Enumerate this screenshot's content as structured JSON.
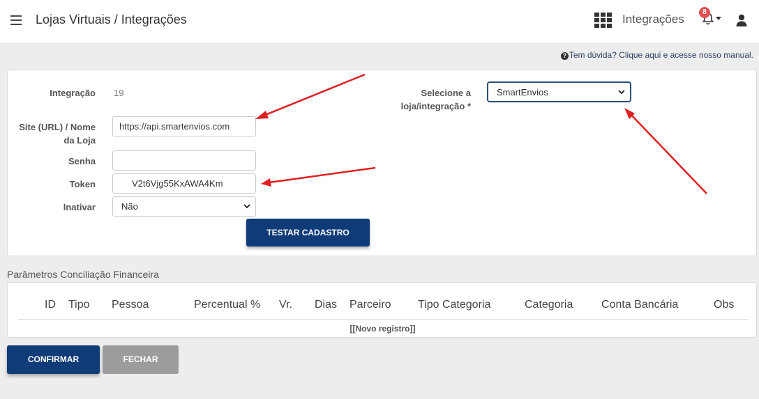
{
  "header": {
    "title": "Lojas Virtuais / Integrações",
    "integrations_link": "Integrações",
    "notification_count": "8"
  },
  "help": {
    "text": "Tem dúvida? Clique aqui e acesse nosso manual."
  },
  "form": {
    "integracao_label": "Integração",
    "integracao_value": "19",
    "site_label": "Site (URL) / Nome da Loja",
    "site_value": "https://api.smartenvios.com",
    "senha_label": "Senha",
    "senha_value": "",
    "token_label": "Token",
    "token_value": "V2t6Vjg55KxAWA4Km",
    "inativar_label": "Inativar",
    "inativar_value": "Não",
    "loja_label": "Selecione a loja/integração *",
    "loja_value": "SmartEnvios",
    "test_button": "TESTAR CADASTRO"
  },
  "conciliacao": {
    "title": "Parâmetros Conciliação Financeira",
    "columns": [
      "ID",
      "Tipo",
      "Pessoa",
      "Percentual %",
      "Vr.",
      "Dias",
      "Parceiro",
      "Tipo Categoria",
      "Categoria",
      "Conta Bancária",
      "Obs"
    ],
    "new_record": "[[Novo registro]]"
  },
  "footer": {
    "confirm": "CONFIRMAR",
    "close": "FECHAR"
  },
  "colors": {
    "primary": "#0f3b78",
    "gray_button": "#9c9c9c",
    "arrow": "#e02020",
    "badge": "#e35050"
  }
}
